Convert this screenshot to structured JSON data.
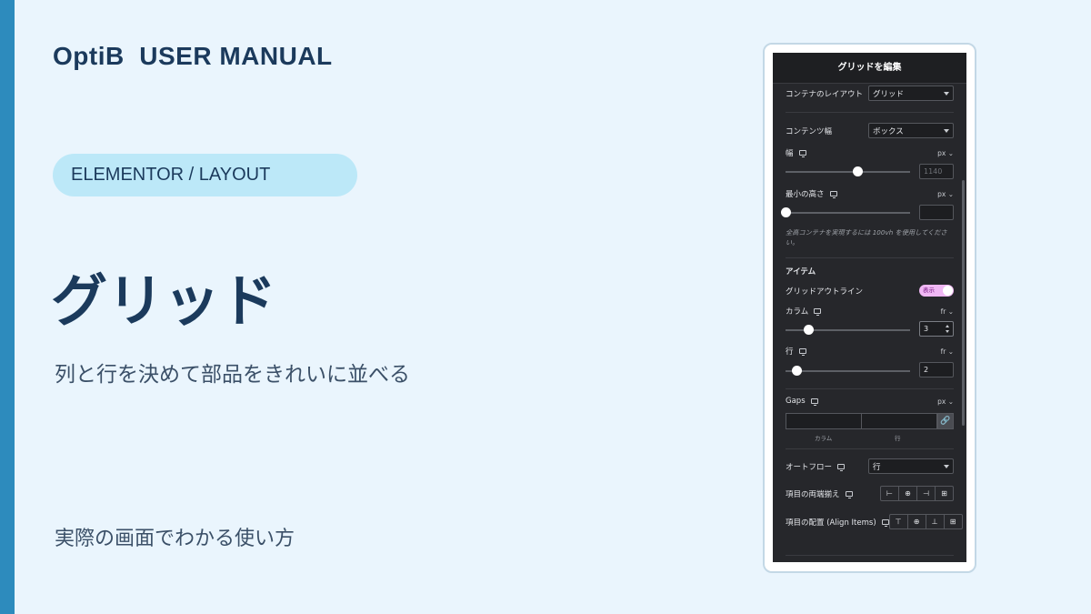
{
  "slide": {
    "brand": "OptiB  USER MANUAL",
    "category": "ELEMENTOR / LAYOUT",
    "title": "グリッド",
    "subtitle": "列と行を決めて部品をきれいに並べる",
    "tagline": "実際の画面でわかる使い方"
  },
  "colors": {
    "accent": "#2d8bbd",
    "background": "#eaf5fd",
    "pill": "#bce8f8",
    "heading": "#1b3a5c",
    "panel": "#26272b",
    "toggle_on": "#f0b7f4"
  },
  "panel": {
    "header": "グリッドを編集",
    "container_layout": {
      "label": "コンテナのレイアウト",
      "value": "グリッド"
    },
    "content_width": {
      "label": "コンテンツ幅",
      "value": "ボックス"
    },
    "width": {
      "label": "幅",
      "unit": "px ⌄",
      "placeholder": "1140",
      "slider": 0.58
    },
    "min_height": {
      "label": "最小の高さ",
      "unit": "px ⌄",
      "value": "",
      "slider": 0.0
    },
    "hint": "全高コンテナを実現するには 100vh を使用してください。",
    "items_heading": "アイテム",
    "grid_outline": {
      "label": "グリッドアウトライン",
      "toggle": "表示"
    },
    "columns": {
      "label": "カラム",
      "unit": "fr ⌄",
      "value": "3",
      "slider": 0.18
    },
    "rows": {
      "label": "行",
      "unit": "fr ⌄",
      "value": "2",
      "slider": 0.09
    },
    "gaps": {
      "label": "Gaps",
      "unit": "px ⌄",
      "col_label": "カラム",
      "row_label": "行",
      "link_icon": "🔗"
    },
    "auto_flow": {
      "label": "オートフロー",
      "value": "行"
    },
    "justify_items": {
      "label": "項目の両端揃え",
      "icons": [
        "⊢",
        "⊕",
        "⊣",
        "⊞"
      ]
    },
    "align_items": {
      "label": "項目の配置 (Align Items)",
      "icons": [
        "⊤",
        "⊕",
        "⊥",
        "⊞"
      ]
    }
  }
}
